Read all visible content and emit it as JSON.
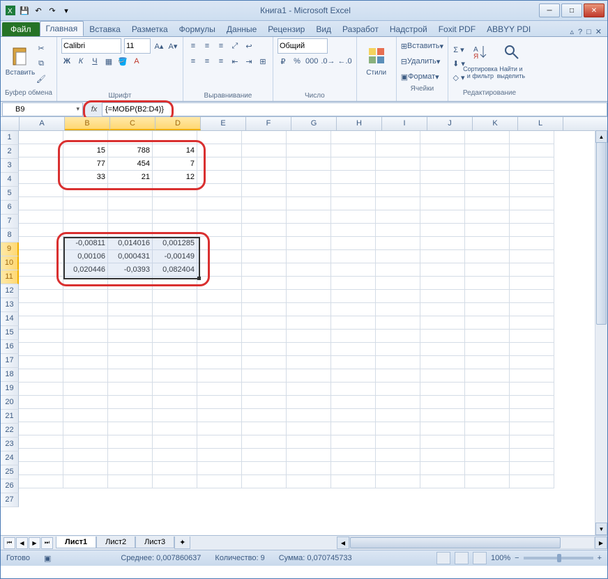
{
  "app_title": "Книга1 - Microsoft Excel",
  "qat": {
    "save": "💾",
    "undo": "↶",
    "redo": "↷"
  },
  "tabs": {
    "file": "Файл",
    "list": [
      "Главная",
      "Вставка",
      "Разметка",
      "Формулы",
      "Данные",
      "Рецензир",
      "Вид",
      "Разработ",
      "Надстрой",
      "Foxit PDF",
      "ABBYY PDI"
    ],
    "active": 0,
    "help_icon": "?"
  },
  "ribbon": {
    "clipboard": {
      "paste": "Вставить",
      "label": "Буфер обмена"
    },
    "font": {
      "name": "Calibri",
      "size": "11",
      "bold": "Ж",
      "italic": "К",
      "underline": "Ч",
      "label": "Шрифт"
    },
    "align": {
      "label": "Выравнивание"
    },
    "number": {
      "format": "Общий",
      "label": "Число"
    },
    "styles": {
      "btn": "Стили",
      "label": ""
    },
    "cells": {
      "insert": "Вставить",
      "delete": "Удалить",
      "format": "Формат",
      "label": "Ячейки"
    },
    "editing": {
      "sort": "Сортировка и фильтр",
      "find": "Найти и выделить",
      "label": "Редактирование"
    }
  },
  "namebox": "B9",
  "fx_label": "fx",
  "formula": "{=МОБР(B2:D4)}",
  "columns": [
    "A",
    "B",
    "C",
    "D",
    "E",
    "F",
    "G",
    "H",
    "I",
    "J",
    "K",
    "L"
  ],
  "rows_count": 27,
  "sel_cols": [
    1,
    2,
    3
  ],
  "sel_rows": [
    9,
    10,
    11
  ],
  "data": {
    "2": {
      "B": "15",
      "C": "788",
      "D": "14"
    },
    "3": {
      "B": "77",
      "C": "454",
      "D": "7"
    },
    "4": {
      "B": "33",
      "C": "21",
      "D": "12"
    },
    "9": {
      "B": "-0,00811",
      "C": "0,014016",
      "D": "0,001285"
    },
    "10": {
      "B": "0,00106",
      "C": "0,000431",
      "D": "-0,00149"
    },
    "11": {
      "B": "0,020446",
      "C": "-0,0393",
      "D": "0,082404"
    }
  },
  "sheets": {
    "list": [
      "Лист1",
      "Лист2",
      "Лист3"
    ],
    "active": 0
  },
  "status": {
    "ready": "Готово",
    "avg_label": "Среднее:",
    "avg": "0,007860637",
    "count_label": "Количество:",
    "count": "9",
    "sum_label": "Сумма:",
    "sum": "0,070745733",
    "zoom": "100%"
  }
}
